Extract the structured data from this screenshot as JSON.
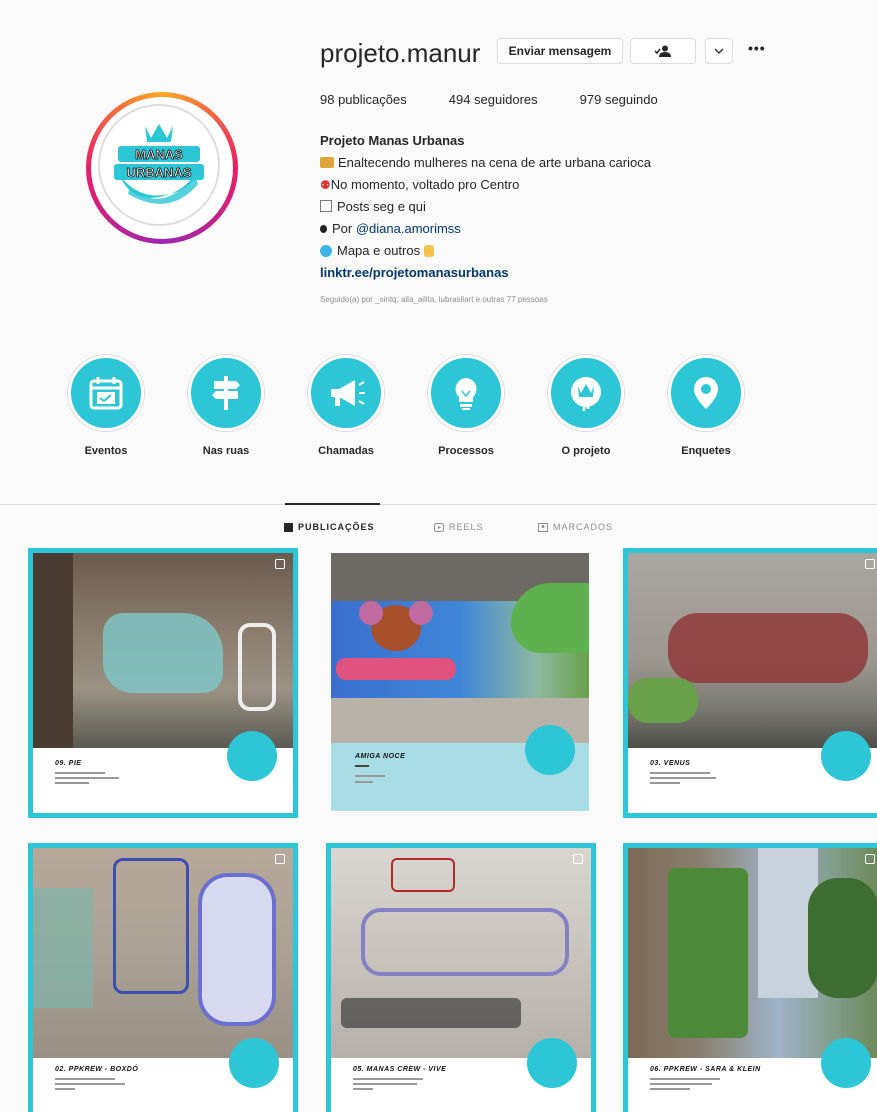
{
  "profile": {
    "username": "projeto.manur",
    "avatar_text": "MANAS URBANAS",
    "buttons": {
      "message": "Enviar mensagem",
      "follow_icon": "person-check-icon",
      "dropdown_icon": "chevron-down-icon",
      "more": "•••"
    },
    "stats": {
      "posts": "98 publicações",
      "followers": "494 seguidores",
      "following": "979 seguindo"
    },
    "bio": {
      "name": "Projeto Manas Urbanas",
      "line1": "Enaltecendo mulheres na cena de arte urbana carioca",
      "line2": "No momento, voltado pro Centro",
      "line3": "Posts seg e qui",
      "line4_prefix": "Por ",
      "line4_mention": "@diana.amorimss",
      "line5": "Mapa e outros",
      "link": "linktr.ee/projetomanasurbanas"
    },
    "followed_by": "Seguido(a) por _sintq, aila_ailita, lubrasilart e outras 77 pessoas"
  },
  "highlights": [
    {
      "label": "Eventos",
      "icon": "calendar-icon"
    },
    {
      "label": "Nas ruas",
      "icon": "signpost-icon"
    },
    {
      "label": "Chamadas",
      "icon": "megaphone-icon"
    },
    {
      "label": "Processos",
      "icon": "lightbulb-icon"
    },
    {
      "label": "O projeto",
      "icon": "crown-logo-icon"
    },
    {
      "label": "Enquetes",
      "icon": "map-pin-icon"
    }
  ],
  "tabs": [
    {
      "label": "PUBLICAÇÕES",
      "icon": "grid-icon",
      "active": true
    },
    {
      "label": "REELS",
      "icon": "reels-icon",
      "active": false
    },
    {
      "label": "MARCADOS",
      "icon": "tag-icon",
      "active": false
    }
  ],
  "posts": [
    {
      "title": "09. PIE"
    },
    {
      "title": "AMIGA NOCE"
    },
    {
      "title": "03. VENUS"
    },
    {
      "title": "02. PPKREW - BOXDÓ"
    },
    {
      "title": "05. MANAS CREW - VIVE"
    },
    {
      "title": "06. PPKREW - SARA & KLEIN"
    }
  ],
  "colors": {
    "accent": "#2dc6d6",
    "link": "#00376b",
    "muted": "#8e8e8e"
  }
}
